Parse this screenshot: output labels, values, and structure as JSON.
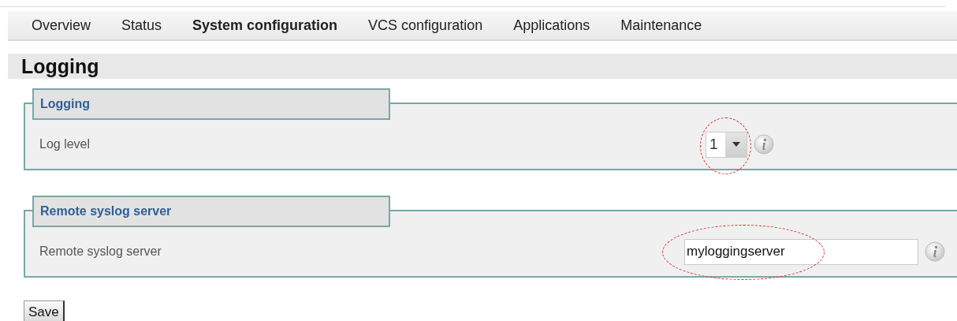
{
  "tabs": [
    {
      "label": "Overview",
      "selected": false
    },
    {
      "label": "Status",
      "selected": false
    },
    {
      "label": "System configuration",
      "selected": true
    },
    {
      "label": "VCS configuration",
      "selected": false
    },
    {
      "label": "Applications",
      "selected": false
    },
    {
      "label": "Maintenance",
      "selected": false
    }
  ],
  "page_title": "Logging",
  "sections": [
    {
      "title": "Logging",
      "fields": [
        {
          "kind": "select",
          "label": "Log level",
          "value": "1",
          "highlighted": true
        }
      ]
    },
    {
      "title": "Remote syslog server",
      "fields": [
        {
          "kind": "text",
          "label": "Remote syslog server",
          "value": "myloggingserver",
          "highlighted": true
        }
      ]
    }
  ],
  "save_button": "Save"
}
